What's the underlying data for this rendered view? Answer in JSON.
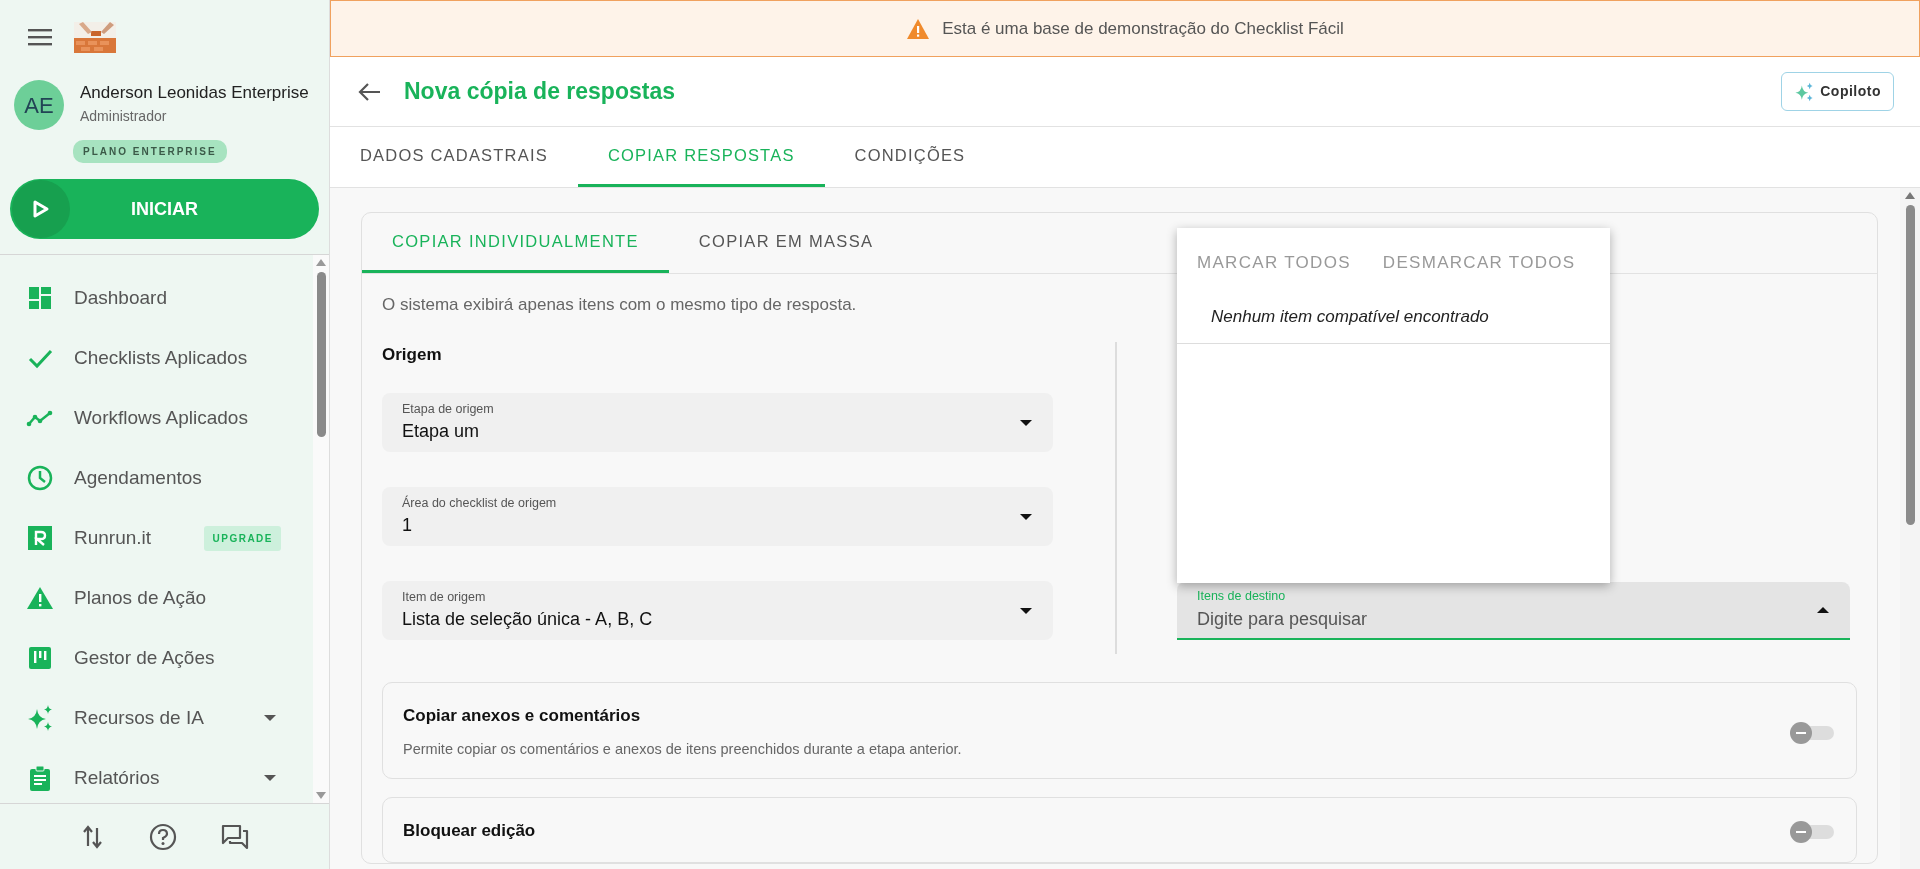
{
  "banner": {
    "text": "Esta é uma base de demonstração do Checklist Fácil"
  },
  "sidebar": {
    "user": {
      "initials": "AE",
      "name": "Anderson Leonidas Enterprise",
      "role": "Administrador",
      "plan": "PLANO ENTERPRISE"
    },
    "start_button": "INICIAR",
    "items": [
      {
        "label": "Dashboard",
        "has_submenu": false
      },
      {
        "label": "Checklists Aplicados",
        "has_submenu": false
      },
      {
        "label": "Workflows Aplicados",
        "has_submenu": false
      },
      {
        "label": "Agendamentos",
        "has_submenu": false
      },
      {
        "label": "Runrun.it",
        "badge": "UPGRADE",
        "has_submenu": false
      },
      {
        "label": "Planos de Ação",
        "has_submenu": false
      },
      {
        "label": "Gestor de Ações",
        "has_submenu": false
      },
      {
        "label": "Recursos de IA",
        "has_submenu": true
      },
      {
        "label": "Relatórios",
        "has_submenu": true
      }
    ]
  },
  "header": {
    "title": "Nova cópia de respostas",
    "copilot_button": "Copiloto"
  },
  "tabs": [
    {
      "label": "DADOS CADASTRAIS",
      "selected": false
    },
    {
      "label": "COPIAR RESPOSTAS",
      "selected": true
    },
    {
      "label": "CONDIÇÕES",
      "selected": false
    }
  ],
  "subtabs": [
    {
      "label": "COPIAR INDIVIDUALMENTE",
      "selected": true
    },
    {
      "label": "COPIAR EM MASSA",
      "selected": false
    }
  ],
  "description": "O sistema exibirá apenas itens com o mesmo tipo de resposta.",
  "origin": {
    "heading": "Origem",
    "fields": [
      {
        "label": "Etapa de origem",
        "value": "Etapa um"
      },
      {
        "label": "Área do checklist de origem",
        "value": "1"
      },
      {
        "label": "Item de origem",
        "value": "Lista de seleção única - A, B, C"
      }
    ]
  },
  "destination": {
    "label": "Itens de destino",
    "placeholder": "Digite para pesquisar",
    "expanded": true,
    "dropdown": {
      "actions": [
        "MARCAR TODOS",
        "DESMARCAR TODOS"
      ],
      "empty_text": "Nenhum item compatível encontrado"
    }
  },
  "options": [
    {
      "title": "Copiar anexos e comentários",
      "description": "Permite copiar os comentários e anexos de itens preenchidos durante a etapa anterior.",
      "on": false
    },
    {
      "title": "Bloquear edição",
      "on": false
    }
  ]
}
